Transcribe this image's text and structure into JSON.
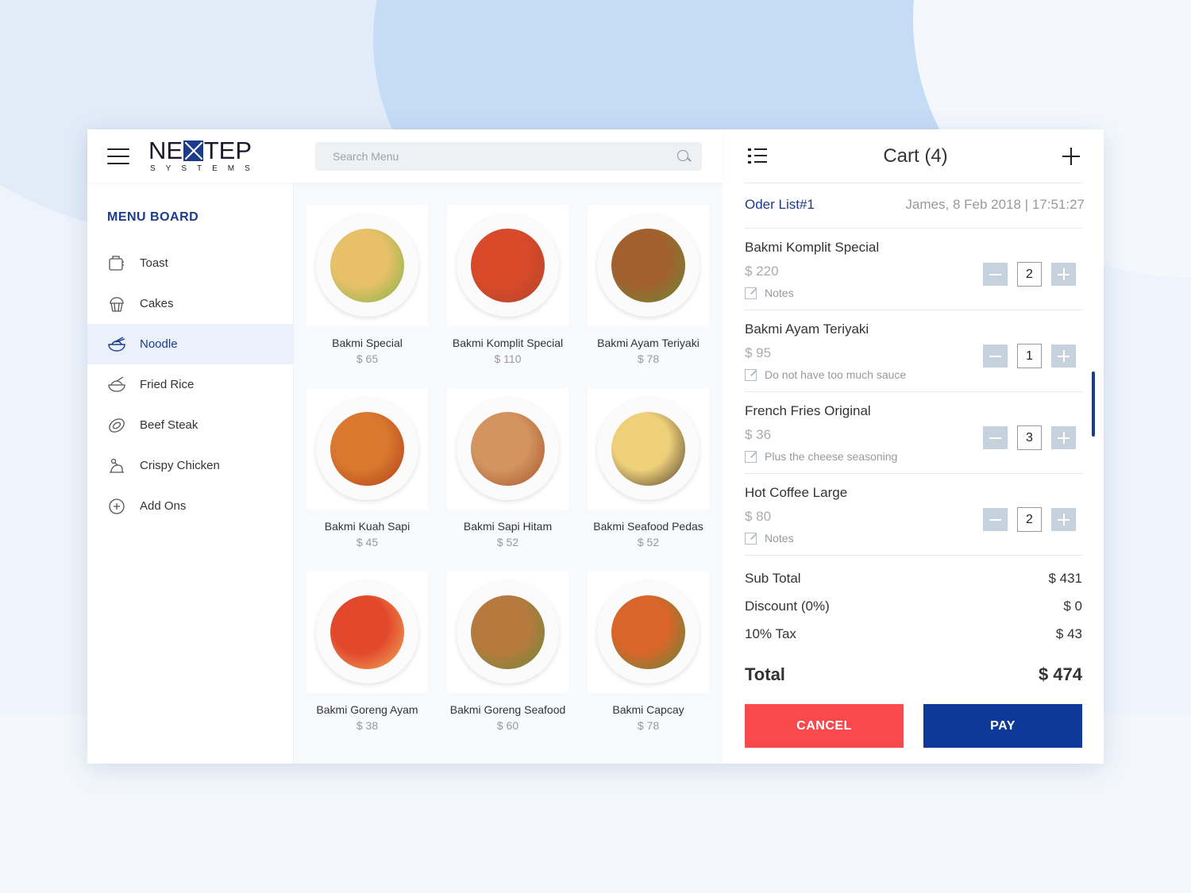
{
  "brand": {
    "logo_left": "NE",
    "logo_right": "TEP",
    "logo_sub": "SYSTEMS"
  },
  "search": {
    "placeholder": "Search Menu"
  },
  "menu_board": {
    "title": "MENU BOARD",
    "categories": [
      {
        "label": "Toast",
        "icon": "toaster-icon"
      },
      {
        "label": "Cakes",
        "icon": "cupcake-icon"
      },
      {
        "label": "Noodle",
        "icon": "noodle-bowl-icon",
        "active": true
      },
      {
        "label": "Fried Rice",
        "icon": "rice-bowl-icon"
      },
      {
        "label": "Beef Steak",
        "icon": "steak-icon"
      },
      {
        "label": "Crispy Chicken",
        "icon": "chicken-icon"
      },
      {
        "label": "Add Ons",
        "icon": "add-circle-icon"
      }
    ]
  },
  "foods": [
    {
      "name": "Bakmi Special",
      "price": "$ 65",
      "colors": [
        "#e8c06a",
        "#7cb342"
      ]
    },
    {
      "name": "Bakmi Komplit Special",
      "price": "$ 110",
      "colors": [
        "#d84a2a",
        "#b0452a"
      ]
    },
    {
      "name": "Bakmi Ayam Teriyaki",
      "price": "$ 78",
      "colors": [
        "#a2602e",
        "#6b8a3a"
      ]
    },
    {
      "name": "Bakmi Kuah Sapi",
      "price": "$ 45",
      "colors": [
        "#d9782e",
        "#b03b1e"
      ]
    },
    {
      "name": "Bakmi Sapi Hitam",
      "price": "$ 52",
      "colors": [
        "#d49460",
        "#a4542a"
      ]
    },
    {
      "name": "Bakmi Seafood Pedas",
      "price": "$ 52",
      "colors": [
        "#efd07a",
        "#4a3a2a"
      ]
    },
    {
      "name": "Bakmi Goreng Ayam",
      "price": "$ 38",
      "colors": [
        "#e2482c",
        "#f0b15a"
      ]
    },
    {
      "name": "Bakmi Goreng Seafood",
      "price": "$ 60",
      "colors": [
        "#b77a3e",
        "#6a8a3a"
      ]
    },
    {
      "name": "Bakmi Capcay",
      "price": "$ 78",
      "colors": [
        "#d9652a",
        "#5a8a3a"
      ]
    }
  ],
  "cart": {
    "title": "Cart (4)",
    "order_id": "Oder List#1",
    "order_meta": "James, 8 Feb 2018 | 17:51:27",
    "items": [
      {
        "name": "Bakmi Komplit Special",
        "price": "$ 220",
        "note": "Notes",
        "qty": "2"
      },
      {
        "name": "Bakmi Ayam Teriyaki",
        "price": "$ 95",
        "note": "Do not have too much sauce",
        "qty": "1"
      },
      {
        "name": "French Fries Original",
        "price": "$ 36",
        "note": "Plus the cheese seasoning",
        "qty": "3"
      },
      {
        "name": "Hot Coffee Large",
        "price": "$ 80",
        "note": "Notes",
        "qty": "2"
      }
    ],
    "subtotal_label": "Sub Total",
    "subtotal": "$ 431",
    "discount_label": "Discount (0%)",
    "discount": "$ 0",
    "tax_label": "10% Tax",
    "tax": "$ 43",
    "total_label": "Total",
    "total": "$ 474",
    "cancel_label": "CANCEL",
    "pay_label": "PAY"
  },
  "colors": {
    "accent": "#1b3c8c",
    "cancel": "#f84a4c",
    "pay": "#0d3a9a"
  }
}
